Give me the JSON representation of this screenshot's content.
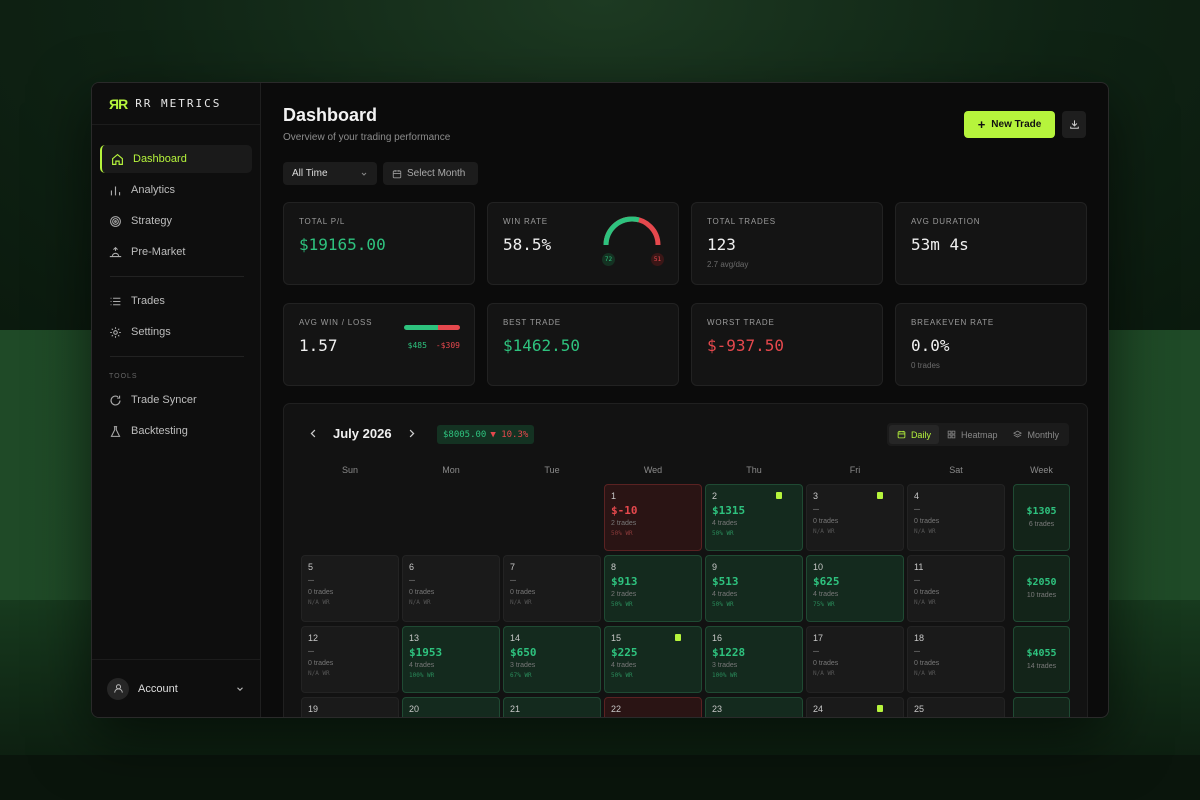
{
  "brand": {
    "logo": "ЯR",
    "name": "RR METRICS"
  },
  "nav": {
    "items": [
      {
        "label": "Dashboard",
        "icon": "home-icon",
        "active": true
      },
      {
        "label": "Analytics",
        "icon": "bar-chart-icon"
      },
      {
        "label": "Strategy",
        "icon": "target-icon"
      },
      {
        "label": "Pre-Market",
        "icon": "sunrise-icon"
      }
    ],
    "items2": [
      {
        "label": "Trades",
        "icon": "list-icon"
      },
      {
        "label": "Settings",
        "icon": "gear-icon"
      }
    ],
    "tools_label": "TOOLS",
    "tools": [
      {
        "label": "Trade Syncer",
        "icon": "refresh-icon"
      },
      {
        "label": "Backtesting",
        "icon": "flask-icon"
      }
    ],
    "account_label": "Account"
  },
  "header": {
    "title": "Dashboard",
    "subtitle": "Overview of your trading performance",
    "new_trade_label": "New Trade",
    "filter_value": "All Time",
    "month_placeholder": "Select Month"
  },
  "stats": {
    "total_pl": {
      "label": "TOTAL P/L",
      "value": "$19165.00"
    },
    "win_rate": {
      "label": "WIN RATE",
      "value": "58.5%",
      "wins": "72",
      "losses": "51",
      "win_fraction": 0.585
    },
    "total_trades": {
      "label": "TOTAL TRADES",
      "value": "123",
      "sub": "2.7 avg/day"
    },
    "avg_duration": {
      "label": "AVG DURATION",
      "value": "53m 4s"
    },
    "avg_win_loss": {
      "label": "AVG WIN / LOSS",
      "value": "1.57",
      "avg_win": "$485",
      "avg_loss": "-$309",
      "win_fraction": 0.61
    },
    "best_trade": {
      "label": "BEST TRADE",
      "value": "$1462.50"
    },
    "worst_trade": {
      "label": "WORST TRADE",
      "value": "$-937.50"
    },
    "breakeven": {
      "label": "BREAKEVEN RATE",
      "value": "0.0%",
      "sub": "0 trades"
    }
  },
  "calendar": {
    "month": "July 2026",
    "month_pl": "$8005.00",
    "month_change": "▼ 10.3%",
    "views": [
      "Daily",
      "Heatmap",
      "Monthly"
    ],
    "active_view": "Daily",
    "days_of_week": [
      "Sun",
      "Mon",
      "Tue",
      "Wed",
      "Thu",
      "Fri",
      "Sat",
      "Week"
    ],
    "weeks": [
      {
        "days": [
          null,
          null,
          null,
          {
            "d": "1",
            "p": "$-10",
            "t": "2 trades",
            "wr": "50% WR",
            "s": "loss"
          },
          {
            "d": "2",
            "p": "$1315",
            "t": "4 trades",
            "wr": "50% WR",
            "s": "win",
            "note": true
          },
          {
            "d": "3",
            "p": "—",
            "t": "0 trades",
            "wr": "N/A WR",
            "note": true
          },
          {
            "d": "4",
            "p": "—",
            "t": "0 trades",
            "wr": "N/A WR"
          }
        ],
        "total": "$1305",
        "trades": "6 trades"
      },
      {
        "days": [
          {
            "d": "5",
            "p": "—",
            "t": "0 trades",
            "wr": "N/A WR"
          },
          {
            "d": "6",
            "p": "—",
            "t": "0 trades",
            "wr": "N/A WR"
          },
          {
            "d": "7",
            "p": "—",
            "t": "0 trades",
            "wr": "N/A WR"
          },
          {
            "d": "8",
            "p": "$913",
            "t": "2 trades",
            "wr": "50% WR",
            "s": "win"
          },
          {
            "d": "9",
            "p": "$513",
            "t": "4 trades",
            "wr": "50% WR",
            "s": "win"
          },
          {
            "d": "10",
            "p": "$625",
            "t": "4 trades",
            "wr": "75% WR",
            "s": "win"
          },
          {
            "d": "11",
            "p": "—",
            "t": "0 trades",
            "wr": "N/A WR"
          }
        ],
        "total": "$2050",
        "trades": "10 trades"
      },
      {
        "days": [
          {
            "d": "12",
            "p": "—",
            "t": "0 trades",
            "wr": "N/A WR"
          },
          {
            "d": "13",
            "p": "$1953",
            "t": "4 trades",
            "wr": "100% WR",
            "s": "win"
          },
          {
            "d": "14",
            "p": "$650",
            "t": "3 trades",
            "wr": "67% WR",
            "s": "win"
          },
          {
            "d": "15",
            "p": "$225",
            "t": "4 trades",
            "wr": "50% WR",
            "s": "win",
            "note": true
          },
          {
            "d": "16",
            "p": "$1228",
            "t": "3 trades",
            "wr": "100% WR",
            "s": "win"
          },
          {
            "d": "17",
            "p": "—",
            "t": "0 trades",
            "wr": "N/A WR"
          },
          {
            "d": "18",
            "p": "—",
            "t": "0 trades",
            "wr": "N/A WR"
          }
        ],
        "total": "$4055",
        "trades": "14 trades"
      },
      {
        "days": [
          {
            "d": "19"
          },
          {
            "d": "20",
            "s": "win"
          },
          {
            "d": "21",
            "s": "win"
          },
          {
            "d": "22",
            "s": "loss"
          },
          {
            "d": "23",
            "s": "win"
          },
          {
            "d": "24",
            "note": true
          },
          {
            "d": "25"
          }
        ],
        "total": "",
        "trades": ""
      }
    ]
  },
  "colors": {
    "accent": "#b6f43c",
    "profit": "#2ec27e",
    "loss": "#e5484d"
  }
}
